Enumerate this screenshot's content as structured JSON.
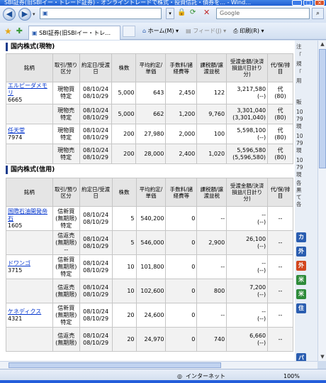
{
  "window": {
    "title": "SBI証券(旧SBIイー・トレード証券) - オンライントレードで株式・投資信託・債券を… - Wind…"
  },
  "nav": {
    "address": "",
    "search_placeholder": "Google"
  },
  "tabs": {
    "favorites_label": "",
    "active_tab": "SBI証券(旧SBIイー・トレ…",
    "home": "ホーム(M)",
    "feed": "フィード(J)",
    "print": "印刷(R)"
  },
  "sections": {
    "spot": {
      "title": "国内株式(現物)"
    },
    "margin": {
      "title": "国内株式(信用)"
    }
  },
  "table_headers": {
    "name": "銘柄",
    "type": "取引/預り区分",
    "date": "約定日/受渡日",
    "qty": "株数",
    "price": "平均約定/単価",
    "fee": "手数料/諸経費等",
    "tax": "課税額/譲渡益税",
    "amount": "受渡金額/決済損益/(日計り分)",
    "agent": "代/保/排目"
  },
  "spot_rows": [
    {
      "name": "エルピーダメモリ",
      "code": "6665",
      "type1": "現物買",
      "type2": "特定",
      "trade_date": "08/10/24",
      "settle_date": "08/10/29",
      "qty": "5,000",
      "price": "643",
      "fee": "2,450",
      "tax": "122",
      "amount": "3,217,580",
      "sub": "(--)",
      "agent1": "代",
      "agent2": "(80)"
    },
    {
      "name": "",
      "code": "",
      "type1": "現物売",
      "type2": "特定",
      "trade_date": "08/10/24",
      "settle_date": "08/10/29",
      "qty": "5,000",
      "price": "662",
      "fee": "1,200",
      "tax": "9,760",
      "amount": "3,301,040",
      "sub": "(3,301,040)",
      "agent1": "代",
      "agent2": "(80)"
    },
    {
      "name": "任天堂",
      "code": "7974",
      "type1": "現物買",
      "type2": "特定",
      "trade_date": "08/10/24",
      "settle_date": "08/10/29",
      "qty": "200",
      "price": "27,980",
      "fee": "2,000",
      "tax": "100",
      "amount": "5,598,100",
      "sub": "(--)",
      "agent1": "代",
      "agent2": "(80)"
    },
    {
      "name": "",
      "code": "",
      "type1": "現物売",
      "type2": "特定",
      "trade_date": "08/10/24",
      "settle_date": "08/10/29",
      "qty": "200",
      "price": "28,000",
      "fee": "2,400",
      "tax": "1,020",
      "amount": "5,596,580",
      "sub": "(5,596,580)",
      "agent1": "代",
      "agent2": "(80)"
    }
  ],
  "margin_rows": [
    {
      "name": "国際石油開発帝石",
      "code": "1605",
      "type1": "信新買",
      "type2": "(無期限)",
      "type3": "特定",
      "trade_date": "08/10/24",
      "settle_date": "08/10/29",
      "qty": "5",
      "price": "540,200",
      "fee": "0",
      "tax": "--",
      "amount": "--",
      "sub": "(--)",
      "agent": "--"
    },
    {
      "name": "",
      "code": "",
      "type1": "信返売",
      "type2": "(無期限)",
      "type3": "--",
      "trade_date": "08/10/24",
      "settle_date": "08/10/29",
      "qty": "5",
      "price": "546,000",
      "fee": "0",
      "tax": "2,900",
      "amount": "26,100",
      "sub": "(--)",
      "agent": "--"
    },
    {
      "name": "ドワンゴ",
      "code": "3715",
      "type1": "信新買",
      "type2": "(無期限)",
      "type3": "特定",
      "trade_date": "08/10/24",
      "settle_date": "08/10/29",
      "qty": "10",
      "price": "101,800",
      "fee": "0",
      "tax": "--",
      "amount": "--",
      "sub": "(--)",
      "agent": "--"
    },
    {
      "name": "",
      "code": "",
      "type1": "信返売",
      "type2": "(無期限)",
      "type3": "",
      "trade_date": "08/10/24",
      "settle_date": "08/10/29",
      "qty": "10",
      "price": "102,600",
      "fee": "0",
      "tax": "800",
      "amount": "7,200",
      "sub": "(--)",
      "agent": "--"
    },
    {
      "name": "ケネディクス",
      "code": "4321",
      "type1": "信新買",
      "type2": "(無期限)",
      "type3": "特定",
      "trade_date": "08/10/24",
      "settle_date": "08/10/29",
      "qty": "20",
      "price": "24,600",
      "fee": "0",
      "tax": "--",
      "amount": "--",
      "sub": "(--)",
      "agent": "--"
    },
    {
      "name": "",
      "code": "",
      "type1": "信返売",
      "type2": "(無期限)",
      "type3": "",
      "trade_date": "08/10/24",
      "settle_date": "08/10/29",
      "qty": "20",
      "price": "24,970",
      "fee": "0",
      "tax": "740",
      "amount": "6,660",
      "sub": "(--)",
      "agent": "--"
    }
  ],
  "sidebar": {
    "texts": [
      "注",
      "「",
      "規",
      "「",
      "用",
      "販",
      "10",
      "79",
      "現",
      "10",
      "79",
      "現",
      "10",
      "79",
      "現",
      "各",
      "黒",
      "て",
      "各"
    ],
    "buttons": [
      {
        "label": "カ",
        "color": "#2a5db0"
      },
      {
        "label": "外",
        "color": "#2a5db0"
      },
      {
        "label": "外",
        "color": "#d2461e"
      },
      {
        "label": "米",
        "color": "#2e8b3a"
      },
      {
        "label": "米",
        "color": "#2e8b3a"
      },
      {
        "label": "住",
        "color": "#2a5db0"
      },
      {
        "label": "パ",
        "color": "#2a5db0"
      }
    ]
  },
  "status": {
    "zone": "インターネット",
    "zoom": "100%"
  }
}
